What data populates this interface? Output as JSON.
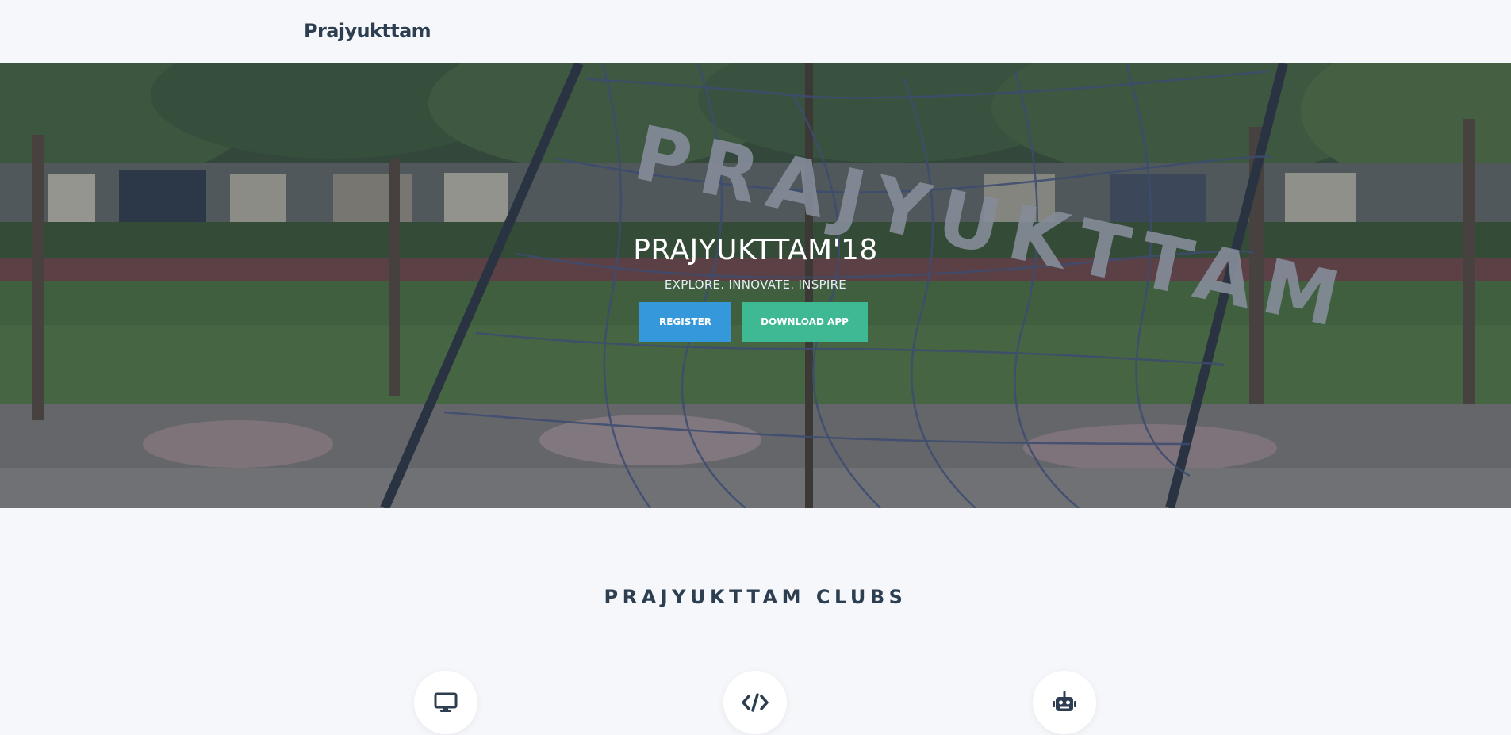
{
  "navbar": {
    "brand": "Prajyukttam"
  },
  "hero": {
    "title": "PRAJYUKTTAM'18",
    "subtitle": "EXPLORE. INNOVATE. INSPIRE",
    "register_label": "REGISTER",
    "download_label": "DOWNLOAD APP",
    "sign_letters": "PRAJYUKTTAM"
  },
  "clubs": {
    "title": "PRAJYUKTTAM CLUBS",
    "items": [
      {
        "icon": "desktop-icon"
      },
      {
        "icon": "code-icon"
      },
      {
        "icon": "robot-icon"
      }
    ]
  },
  "colors": {
    "text_dark": "#2c3e50",
    "register": "#3498db",
    "download": "#3fb894",
    "page_bg": "#f5f7fa"
  }
}
